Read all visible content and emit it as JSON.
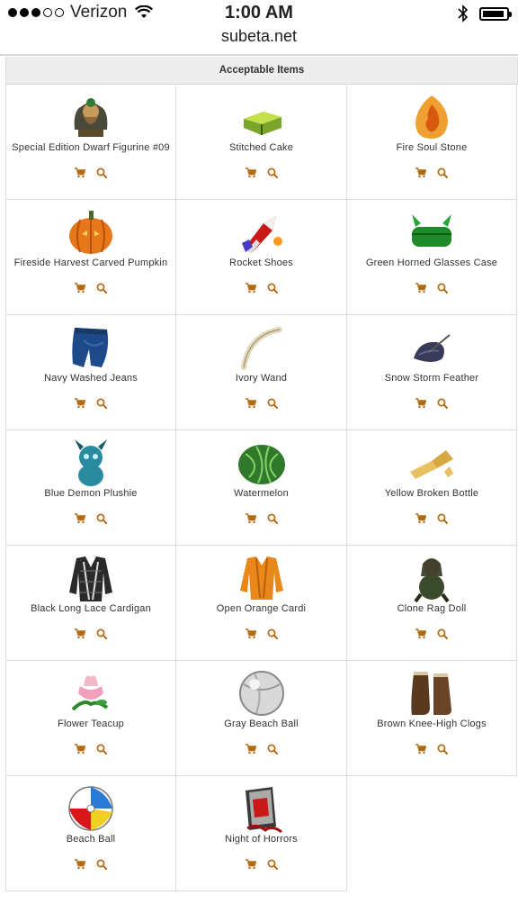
{
  "status_bar": {
    "carrier": "Verizon",
    "time": "1:00 AM",
    "signal_bars_filled": 3,
    "signal_bars_total": 5,
    "icons": [
      "wifi-icon",
      "bluetooth-icon",
      "battery-icon"
    ]
  },
  "browser": {
    "url": "subeta.net"
  },
  "table": {
    "title": "Acceptable Items",
    "items": [
      {
        "name": "Special Edition Dwarf Figurine #09",
        "icon": "dwarf-figurine-icon"
      },
      {
        "name": "Stitched Cake",
        "icon": "cake-icon"
      },
      {
        "name": "Fire Soul Stone",
        "icon": "fire-stone-icon"
      },
      {
        "name": "Fireside Harvest Carved Pumpkin",
        "icon": "pumpkin-icon"
      },
      {
        "name": "Rocket Shoes",
        "icon": "rocket-shoes-icon"
      },
      {
        "name": "Green Horned Glasses Case",
        "icon": "glasses-case-icon"
      },
      {
        "name": "Navy Washed Jeans",
        "icon": "jeans-icon"
      },
      {
        "name": "Ivory Wand",
        "icon": "wand-icon"
      },
      {
        "name": "Snow Storm Feather",
        "icon": "feather-icon"
      },
      {
        "name": "Blue Demon Plushie",
        "icon": "plushie-icon"
      },
      {
        "name": "Watermelon",
        "icon": "watermelon-icon"
      },
      {
        "name": "Yellow Broken Bottle",
        "icon": "bottle-icon"
      },
      {
        "name": "Black Long Lace Cardigan",
        "icon": "cardigan-icon"
      },
      {
        "name": "Open Orange Cardi",
        "icon": "orange-cardi-icon"
      },
      {
        "name": "Clone Rag Doll",
        "icon": "rag-doll-icon"
      },
      {
        "name": "Flower Teacup",
        "icon": "teacup-icon"
      },
      {
        "name": "Gray Beach Ball",
        "icon": "gray-beach-ball-icon"
      },
      {
        "name": "Brown Knee-High Clogs",
        "icon": "clogs-icon"
      },
      {
        "name": "Beach Ball",
        "icon": "beach-ball-icon"
      },
      {
        "name": "Night of Horrors",
        "icon": "horror-book-icon"
      }
    ],
    "action_icons": [
      "cart-icon",
      "search-icon"
    ],
    "action_color": "#b26b14"
  }
}
